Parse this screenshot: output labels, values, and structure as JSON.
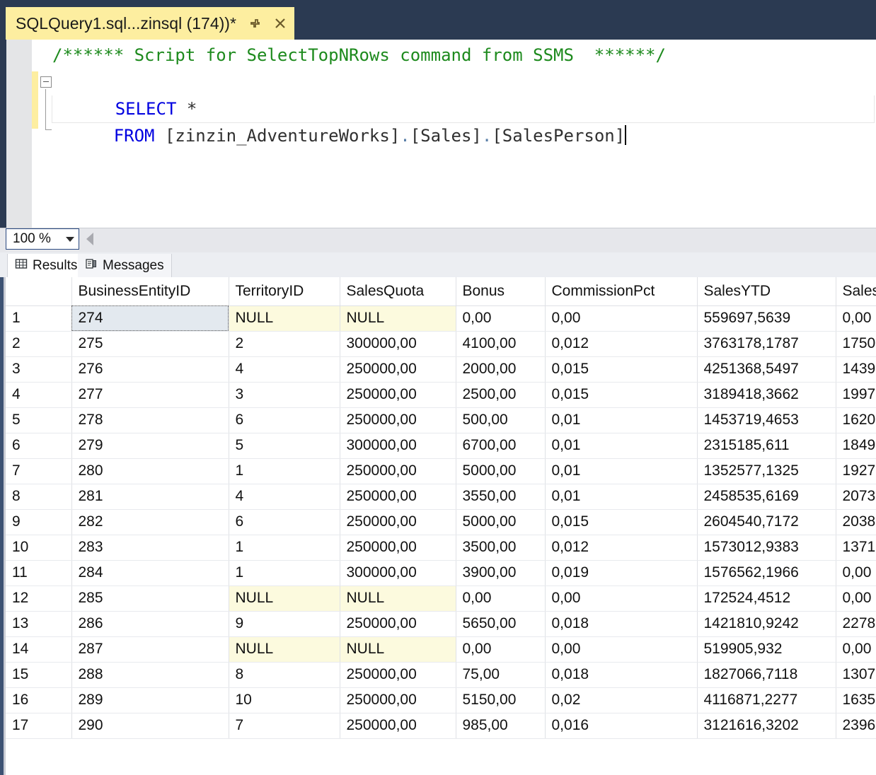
{
  "window": {
    "tab": {
      "title": "SQLQuery1.sql...zinsql (174))*",
      "pin_icon": "pin-icon",
      "close_icon": "close-icon"
    }
  },
  "editor": {
    "comment_line": "/****** Script for SelectTopNRows command from SSMS  ******/",
    "select_keyword": "SELECT",
    "select_star": " *",
    "from_keyword": "FROM",
    "from_target_db": " [zinzin_AdventureWorks]",
    "dot1": ".",
    "from_schema": "[Sales]",
    "dot2": ".",
    "from_table": "[SalesPerson]"
  },
  "zoom_bar": {
    "zoom_value": "100 %",
    "dropdown_icon": "chevron-down-icon",
    "splitter_icon": "left-arrow-icon"
  },
  "result_tabs": [
    {
      "label": "Results",
      "icon": "grid-icon",
      "active": true
    },
    {
      "label": "Messages",
      "icon": "message-icon",
      "active": false
    }
  ],
  "grid": {
    "columns": [
      "BusinessEntityID",
      "TerritoryID",
      "SalesQuota",
      "Bonus",
      "CommissionPct",
      "SalesYTD",
      "Sales"
    ],
    "rows": [
      {
        "n": "1",
        "BusinessEntityID": "274",
        "TerritoryID": "NULL",
        "SalesQuota": "NULL",
        "Bonus": "0,00",
        "CommissionPct": "0,00",
        "SalesYTD": "559697,5639",
        "Sales": "0,00"
      },
      {
        "n": "2",
        "BusinessEntityID": "275",
        "TerritoryID": "2",
        "SalesQuota": "300000,00",
        "Bonus": "4100,00",
        "CommissionPct": "0,012",
        "SalesYTD": "3763178,1787",
        "Sales": "1750"
      },
      {
        "n": "3",
        "BusinessEntityID": "276",
        "TerritoryID": "4",
        "SalesQuota": "250000,00",
        "Bonus": "2000,00",
        "CommissionPct": "0,015",
        "SalesYTD": "4251368,5497",
        "Sales": "1439"
      },
      {
        "n": "4",
        "BusinessEntityID": "277",
        "TerritoryID": "3",
        "SalesQuota": "250000,00",
        "Bonus": "2500,00",
        "CommissionPct": "0,015",
        "SalesYTD": "3189418,3662",
        "Sales": "1997"
      },
      {
        "n": "5",
        "BusinessEntityID": "278",
        "TerritoryID": "6",
        "SalesQuota": "250000,00",
        "Bonus": "500,00",
        "CommissionPct": "0,01",
        "SalesYTD": "1453719,4653",
        "Sales": "1620"
      },
      {
        "n": "6",
        "BusinessEntityID": "279",
        "TerritoryID": "5",
        "SalesQuota": "300000,00",
        "Bonus": "6700,00",
        "CommissionPct": "0,01",
        "SalesYTD": "2315185,611",
        "Sales": "1849"
      },
      {
        "n": "7",
        "BusinessEntityID": "280",
        "TerritoryID": "1",
        "SalesQuota": "250000,00",
        "Bonus": "5000,00",
        "CommissionPct": "0,01",
        "SalesYTD": "1352577,1325",
        "Sales": "1927"
      },
      {
        "n": "8",
        "BusinessEntityID": "281",
        "TerritoryID": "4",
        "SalesQuota": "250000,00",
        "Bonus": "3550,00",
        "CommissionPct": "0,01",
        "SalesYTD": "2458535,6169",
        "Sales": "2073"
      },
      {
        "n": "9",
        "BusinessEntityID": "282",
        "TerritoryID": "6",
        "SalesQuota": "250000,00",
        "Bonus": "5000,00",
        "CommissionPct": "0,015",
        "SalesYTD": "2604540,7172",
        "Sales": "2038"
      },
      {
        "n": "10",
        "BusinessEntityID": "283",
        "TerritoryID": "1",
        "SalesQuota": "250000,00",
        "Bonus": "3500,00",
        "CommissionPct": "0,012",
        "SalesYTD": "1573012,9383",
        "Sales": "1371"
      },
      {
        "n": "11",
        "BusinessEntityID": "284",
        "TerritoryID": "1",
        "SalesQuota": "300000,00",
        "Bonus": "3900,00",
        "CommissionPct": "0,019",
        "SalesYTD": "1576562,1966",
        "Sales": "0,00"
      },
      {
        "n": "12",
        "BusinessEntityID": "285",
        "TerritoryID": "NULL",
        "SalesQuota": "NULL",
        "Bonus": "0,00",
        "CommissionPct": "0,00",
        "SalesYTD": "172524,4512",
        "Sales": "0,00"
      },
      {
        "n": "13",
        "BusinessEntityID": "286",
        "TerritoryID": "9",
        "SalesQuota": "250000,00",
        "Bonus": "5650,00",
        "CommissionPct": "0,018",
        "SalesYTD": "1421810,9242",
        "Sales": "2278"
      },
      {
        "n": "14",
        "BusinessEntityID": "287",
        "TerritoryID": "NULL",
        "SalesQuota": "NULL",
        "Bonus": "0,00",
        "CommissionPct": "0,00",
        "SalesYTD": "519905,932",
        "Sales": "0,00"
      },
      {
        "n": "15",
        "BusinessEntityID": "288",
        "TerritoryID": "8",
        "SalesQuota": "250000,00",
        "Bonus": "75,00",
        "CommissionPct": "0,018",
        "SalesYTD": "1827066,7118",
        "Sales": "1307"
      },
      {
        "n": "16",
        "BusinessEntityID": "289",
        "TerritoryID": "10",
        "SalesQuota": "250000,00",
        "Bonus": "5150,00",
        "CommissionPct": "0,02",
        "SalesYTD": "4116871,2277",
        "Sales": "1635"
      },
      {
        "n": "17",
        "BusinessEntityID": "290",
        "TerritoryID": "7",
        "SalesQuota": "250000,00",
        "Bonus": "985,00",
        "CommissionPct": "0,016",
        "SalesYTD": "3121616,3202",
        "Sales": "2396"
      }
    ],
    "selected_cell": {
      "row": 0,
      "column": "BusinessEntityID"
    },
    "null_token": "NULL"
  },
  "colors": {
    "chrome": "#2b3a52",
    "tab_active": "#fdeea0",
    "comment_green": "#1d8a1d",
    "keyword_blue": "#0000e0",
    "null_cell": "#fcfade",
    "selected_cell": "#e3e9ef"
  }
}
